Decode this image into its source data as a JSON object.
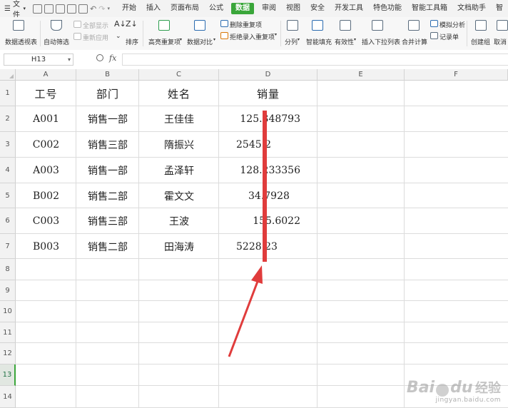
{
  "menubar": {
    "file_label": "文件",
    "tabs": [
      {
        "label": "开始",
        "active": false
      },
      {
        "label": "插入",
        "active": false
      },
      {
        "label": "页面布局",
        "active": false
      },
      {
        "label": "公式",
        "active": false
      },
      {
        "label": "数据",
        "active": true
      },
      {
        "label": "审阅",
        "active": false
      },
      {
        "label": "视图",
        "active": false
      },
      {
        "label": "安全",
        "active": false
      },
      {
        "label": "开发工具",
        "active": false
      },
      {
        "label": "特色功能",
        "active": false
      },
      {
        "label": "智能工具箱",
        "active": false
      },
      {
        "label": "文档助手",
        "active": false
      },
      {
        "label": "智",
        "active": false
      }
    ],
    "accent": "#3aa63a"
  },
  "ribbon": {
    "pivot": "数据透视表",
    "auto_filter": "自动筛选",
    "show_all": "全部显示",
    "reapply": "重新应用",
    "sort": "排序",
    "highlight_dup": "高亮重复项",
    "compare": "数据对比",
    "remove_dup": "删除重复项",
    "reject_dup": "拒绝录入重复项",
    "split": "分列",
    "fill": "智能填充",
    "validity": "有效性",
    "dropdown": "插入下拉列表",
    "consolidate": "合并计算",
    "simulate": "模拟分析",
    "record": "记录单",
    "create_group": "创建组",
    "ungroup": "取消"
  },
  "formula_bar": {
    "name_box": "H13",
    "fx": "fx",
    "content": ""
  },
  "sheet": {
    "columns": [
      "A",
      "B",
      "C",
      "D",
      "E",
      "F"
    ],
    "rows": [
      "1",
      "2",
      "3",
      "4",
      "5",
      "6",
      "7",
      "8",
      "9",
      "10",
      "11",
      "12",
      "13",
      "14"
    ],
    "selected_row": "13",
    "header": {
      "a": "工号",
      "b": "部门",
      "c": "姓名",
      "d": "销量"
    },
    "data": [
      {
        "a": "A001",
        "b": "销售一部",
        "c": "王佳佳",
        "d": "125.348793"
      },
      {
        "a": "C002",
        "b": "销售三部",
        "c": "隋振兴",
        "d": "2545.2"
      },
      {
        "a": "A003",
        "b": "销售一部",
        "c": "孟泽轩",
        "d": "128.233356"
      },
      {
        "a": "B002",
        "b": "销售二部",
        "c": "霍文文",
        "d": "34.7928"
      },
      {
        "a": "C003",
        "b": "销售三部",
        "c": "王波",
        "d": "155.6022"
      },
      {
        "a": "B003",
        "b": "销售二部",
        "c": "田海涛",
        "d": "5228.23"
      }
    ]
  },
  "annotation": {
    "color": "#e03c3c"
  },
  "watermark": {
    "logo": "Bai",
    "logo_tail": "du",
    "cn": "经验",
    "url": "jingyan.baidu.com"
  }
}
